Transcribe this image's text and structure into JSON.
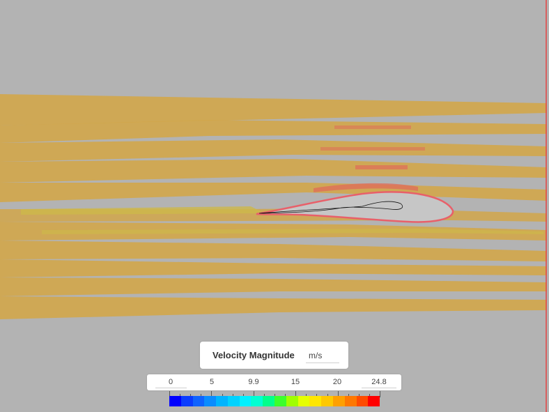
{
  "viewport": {
    "background": "#b3b3b3",
    "streamline_color": "#d1a64a",
    "highlight_color": "#e06b5a",
    "airfoil_outline_color": "#e8606a",
    "boundary_color": "#e34a4a"
  },
  "legend": {
    "title": "Velocity Magnitude",
    "unit": "m/s",
    "tick_labels": [
      "0",
      "5",
      "9.9",
      "15",
      "20",
      "24.8"
    ],
    "colors": [
      "#0000ff",
      "#0a3cff",
      "#0f63ff",
      "#0a8cff",
      "#00b4ff",
      "#00d2ff",
      "#00f0ff",
      "#00ffd2",
      "#00ff8c",
      "#3cff2d",
      "#a0ff00",
      "#e6ff00",
      "#ffe600",
      "#ffc800",
      "#ffa000",
      "#ff7800",
      "#ff4b00",
      "#ff0000"
    ]
  }
}
